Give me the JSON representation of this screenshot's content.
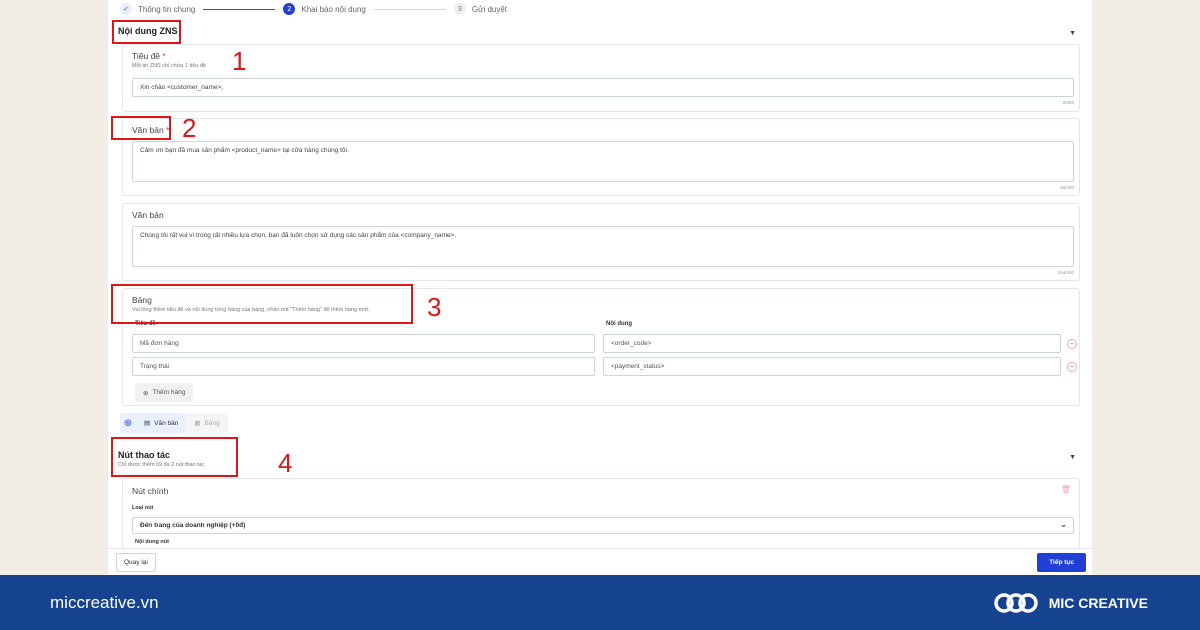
{
  "stepper": [
    {
      "num": "",
      "label": "Thông tin chung"
    },
    {
      "num": "2",
      "label": "Khai báo nội dung"
    },
    {
      "num": "3",
      "label": "Gửi duyệt"
    }
  ],
  "zns_section": {
    "title": "Nội dung ZNS"
  },
  "title_card": {
    "label": "Tiêu đề",
    "required": "*",
    "hint": "Mỗi tin ZNS chỉ chứa 1 tiêu đề",
    "value": "Xin chào <customer_name>,",
    "counter": "25/65"
  },
  "text_card_1": {
    "label": "Văn bản",
    "required": "*",
    "value": "Cảm ơn bạn đã mua sản phẩm <product_name> tại cửa hàng chúng tôi.",
    "counter": "66/400"
  },
  "text_card_2": {
    "label": "Văn bản",
    "value": "Chúng tôi rất vui vì trong rất nhiều lựa chọn, bạn đã luôn chọn sử dụng các sản phẩm của <company_name>.",
    "counter": "104/400"
  },
  "table_card": {
    "label": "Bảng",
    "hint": "Vui lòng thêm tiêu đề và nội dung từng hàng của bảng, nhấn nút \"Thêm hàng\" để thêm hàng mới.",
    "col_title": "Tiêu đề",
    "col_content": "Nội dung",
    "rows": [
      {
        "title": "Mã đơn hàng",
        "content": "<order_code>"
      },
      {
        "title": "Trạng thái",
        "content": "<payment_status>"
      }
    ],
    "add_row": "Thêm hàng"
  },
  "tabs": {
    "text": "Văn bản",
    "table": "Bảng"
  },
  "actions_section": {
    "title": "Nút thao tác",
    "hint": "Chỉ được thêm tối đa 2 nút thao tác"
  },
  "main_button": {
    "label": "Nút chính",
    "type_label": "Loại nút",
    "type_value": "Đến trang của doanh nghiệp (+0đ)",
    "content_label": "Nội dung nút"
  },
  "footer_buttons": {
    "back": "Quay lại",
    "next": "Tiếp tục"
  },
  "annotations": [
    "1",
    "2",
    "3",
    "4"
  ],
  "brand": {
    "url": "miccreative.vn",
    "name": "MIC CREATIVE"
  },
  "colors": {
    "accent": "#1f3fd6",
    "annotation": "#e01515",
    "footer": "#16438f"
  }
}
